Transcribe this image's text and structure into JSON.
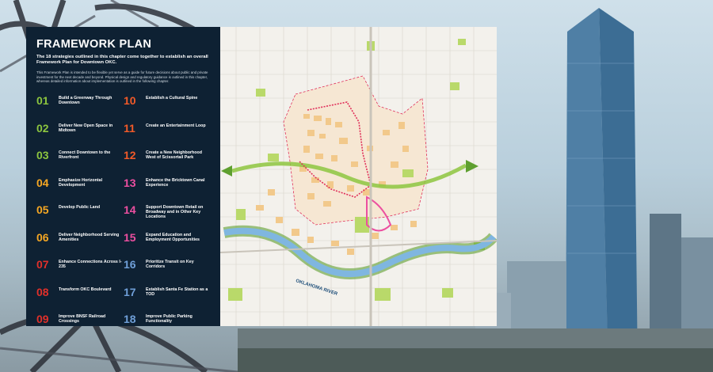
{
  "panel": {
    "title": "FRAMEWORK PLAN",
    "intro": "The 18 strategies outlined in this chapter come together to establish an overall Framework Plan for Downtown OKC.",
    "body": "This Framework Plan is intended to be flexible yet serve as a guide for future decisions about public and private investment for the next decade and beyond. Physical design and regulatory guidance is outlined in this chapter, whereas detailed information about implementation is outlined in the following chapter."
  },
  "strategies": [
    {
      "num": "01",
      "label": "Build a Greenway Through Downtown",
      "color": "#8dc63f"
    },
    {
      "num": "02",
      "label": "Deliver New Open Space in Midtown",
      "color": "#8dc63f"
    },
    {
      "num": "03",
      "label": "Connect Downtown to the Riverfront",
      "color": "#8dc63f"
    },
    {
      "num": "04",
      "label": "Emphasize Horizontal Development",
      "color": "#f7a823"
    },
    {
      "num": "05",
      "label": "Develop Public Land",
      "color": "#f7a823"
    },
    {
      "num": "06",
      "label": "Deliver Neighborhood Serving Amenities",
      "color": "#f7a823"
    },
    {
      "num": "07",
      "label": "Enhance Connections Across I-235",
      "color": "#e1302a"
    },
    {
      "num": "08",
      "label": "Transform OKC Boulevard",
      "color": "#e1302a"
    },
    {
      "num": "09",
      "label": "Improve BNSF Railroad Crossings",
      "color": "#e1302a"
    },
    {
      "num": "10",
      "label": "Establish a Cultural Spine",
      "color": "#f15a29"
    },
    {
      "num": "11",
      "label": "Create an Entertainment Loop",
      "color": "#f15a29"
    },
    {
      "num": "12",
      "label": "Create a New Neighborhood West of Scissortail Park",
      "color": "#f15a29"
    },
    {
      "num": "13",
      "label": "Enhance the Bricktown Canal Experience",
      "color": "#ec4fa0"
    },
    {
      "num": "14",
      "label": "Support Downtown Retail on Broadway and in Other Key Locations",
      "color": "#ec4fa0"
    },
    {
      "num": "15",
      "label": "Expand Education and Employment Opportunities",
      "color": "#ec4fa0"
    },
    {
      "num": "16",
      "label": "Prioritize Transit on Key Corridors",
      "color": "#6f9fd8"
    },
    {
      "num": "17",
      "label": "Establish Santa Fe Station as a TOD",
      "color": "#6f9fd8"
    },
    {
      "num": "18",
      "label": "Improve Public Parking Functionality",
      "color": "#6f9fd8"
    }
  ],
  "map": {
    "river_label": "OKLAHOMA RIVER"
  },
  "colors": {
    "panel_bg": "#0e2133",
    "green": "#8dc63f",
    "river": "#7fb6e0",
    "route": "#e0305a"
  }
}
